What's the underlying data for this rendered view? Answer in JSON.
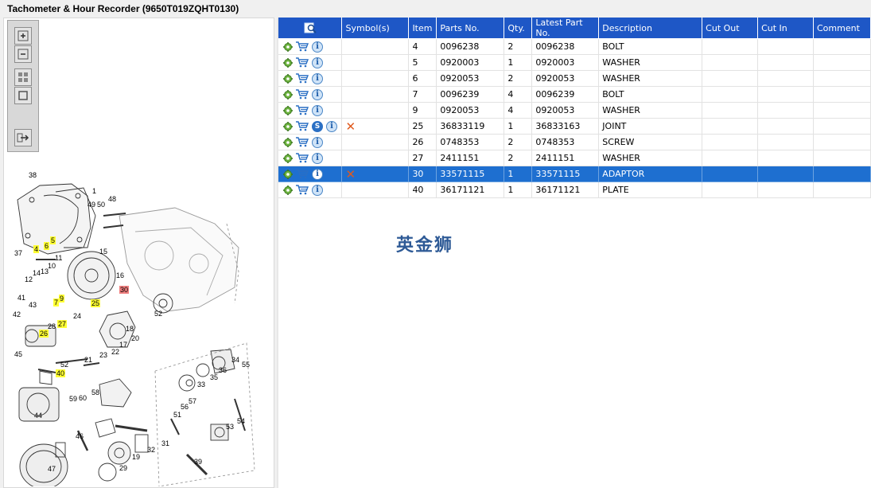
{
  "window": {
    "title": "Tachometer & Hour Recorder (9650T019ZQHT0130)"
  },
  "toolbar": {
    "buttons": [
      {
        "name": "zoom-in-button",
        "icon": "zoom-in-icon"
      },
      {
        "name": "zoom-out-button",
        "icon": "zoom-out-icon"
      },
      {
        "name": "fit-all-button",
        "icon": "fit-all-icon"
      },
      {
        "name": "fit-page-button",
        "icon": "fit-page-icon"
      },
      {
        "name": "export-button",
        "icon": "export-icon"
      }
    ]
  },
  "table": {
    "headers": [
      "",
      "Symbol(s)",
      "Item",
      "Parts No.",
      "Qty.",
      "Latest Part No.",
      "Description",
      "Cut Out",
      "Cut In",
      "Comment"
    ],
    "rows": [
      {
        "item": "4",
        "parts_no": "0096238",
        "qty": "2",
        "latest": "0096238",
        "desc": "BOLT",
        "cut_out": "",
        "cut_in": "",
        "comment": "",
        "has_s": false,
        "symbol_x": false,
        "selected": false
      },
      {
        "item": "5",
        "parts_no": "0920003",
        "qty": "1",
        "latest": "0920003",
        "desc": "WASHER",
        "cut_out": "",
        "cut_in": "",
        "comment": "",
        "has_s": false,
        "symbol_x": false,
        "selected": false
      },
      {
        "item": "6",
        "parts_no": "0920053",
        "qty": "2",
        "latest": "0920053",
        "desc": "WASHER",
        "cut_out": "",
        "cut_in": "",
        "comment": "",
        "has_s": false,
        "symbol_x": false,
        "selected": false
      },
      {
        "item": "7",
        "parts_no": "0096239",
        "qty": "4",
        "latest": "0096239",
        "desc": "BOLT",
        "cut_out": "",
        "cut_in": "",
        "comment": "",
        "has_s": false,
        "symbol_x": false,
        "selected": false
      },
      {
        "item": "9",
        "parts_no": "0920053",
        "qty": "4",
        "latest": "0920053",
        "desc": "WASHER",
        "cut_out": "",
        "cut_in": "",
        "comment": "",
        "has_s": false,
        "symbol_x": false,
        "selected": false
      },
      {
        "item": "25",
        "parts_no": "36833119",
        "qty": "1",
        "latest": "36833163",
        "desc": "JOINT",
        "cut_out": "",
        "cut_in": "",
        "comment": "",
        "has_s": true,
        "symbol_x": true,
        "selected": false
      },
      {
        "item": "26",
        "parts_no": "0748353",
        "qty": "2",
        "latest": "0748353",
        "desc": "SCREW",
        "cut_out": "",
        "cut_in": "",
        "comment": "",
        "has_s": false,
        "symbol_x": false,
        "selected": false
      },
      {
        "item": "27",
        "parts_no": "2411151",
        "qty": "2",
        "latest": "2411151",
        "desc": "WASHER",
        "cut_out": "",
        "cut_in": "",
        "comment": "",
        "has_s": false,
        "symbol_x": false,
        "selected": false
      },
      {
        "item": "30",
        "parts_no": "33571115",
        "qty": "1",
        "latest": "33571115",
        "desc": "ADAPTOR",
        "cut_out": "",
        "cut_in": "",
        "comment": "",
        "has_s": false,
        "symbol_x": true,
        "selected": true
      },
      {
        "item": "40",
        "parts_no": "36171121",
        "qty": "1",
        "latest": "36171121",
        "desc": "PLATE",
        "cut_out": "",
        "cut_in": "",
        "comment": "",
        "has_s": false,
        "symbol_x": false,
        "selected": false
      }
    ],
    "icons": {
      "gear": "gear-icon",
      "cart": "cart-icon",
      "info": "info-icon",
      "s_badge": "S",
      "info_glyph": "i",
      "symbol_glyph": "✕"
    }
  },
  "watermark": "英金狮",
  "diagram": {
    "callouts": [
      {
        "label": "38",
        "hl": ""
      },
      {
        "label": "1",
        "hl": ""
      },
      {
        "label": "49",
        "hl": ""
      },
      {
        "label": "50",
        "hl": ""
      },
      {
        "label": "48",
        "hl": ""
      },
      {
        "label": "37",
        "hl": ""
      },
      {
        "label": "4",
        "hl": "yellow"
      },
      {
        "label": "6",
        "hl": "yellow"
      },
      {
        "label": "5",
        "hl": "yellow"
      },
      {
        "label": "15",
        "hl": ""
      },
      {
        "label": "10",
        "hl": ""
      },
      {
        "label": "11",
        "hl": ""
      },
      {
        "label": "14",
        "hl": ""
      },
      {
        "label": "13",
        "hl": ""
      },
      {
        "label": "12",
        "hl": ""
      },
      {
        "label": "16",
        "hl": ""
      },
      {
        "label": "30",
        "hl": "red"
      },
      {
        "label": "41",
        "hl": ""
      },
      {
        "label": "43",
        "hl": ""
      },
      {
        "label": "9",
        "hl": "yellow"
      },
      {
        "label": "7",
        "hl": "yellow"
      },
      {
        "label": "25",
        "hl": "yellow"
      },
      {
        "label": "42",
        "hl": ""
      },
      {
        "label": "28",
        "hl": ""
      },
      {
        "label": "24",
        "hl": ""
      },
      {
        "label": "26",
        "hl": "yellow"
      },
      {
        "label": "27",
        "hl": "yellow"
      },
      {
        "label": "52",
        "hl": ""
      },
      {
        "label": "18",
        "hl": ""
      },
      {
        "label": "20",
        "hl": ""
      },
      {
        "label": "17",
        "hl": ""
      },
      {
        "label": "22",
        "hl": ""
      },
      {
        "label": "23",
        "hl": ""
      },
      {
        "label": "45",
        "hl": ""
      },
      {
        "label": "21",
        "hl": ""
      },
      {
        "label": "52",
        "hl": ""
      },
      {
        "label": "40",
        "hl": "yellow"
      },
      {
        "label": "34",
        "hl": ""
      },
      {
        "label": "36",
        "hl": ""
      },
      {
        "label": "35",
        "hl": ""
      },
      {
        "label": "55",
        "hl": ""
      },
      {
        "label": "33",
        "hl": ""
      },
      {
        "label": "54",
        "hl": ""
      },
      {
        "label": "59",
        "hl": ""
      },
      {
        "label": "60",
        "hl": ""
      },
      {
        "label": "58",
        "hl": ""
      },
      {
        "label": "44",
        "hl": ""
      },
      {
        "label": "57",
        "hl": ""
      },
      {
        "label": "56",
        "hl": ""
      },
      {
        "label": "51",
        "hl": ""
      },
      {
        "label": "53",
        "hl": ""
      },
      {
        "label": "46",
        "hl": ""
      },
      {
        "label": "31",
        "hl": ""
      },
      {
        "label": "32",
        "hl": ""
      },
      {
        "label": "19",
        "hl": ""
      },
      {
        "label": "29",
        "hl": ""
      },
      {
        "label": "47",
        "hl": ""
      },
      {
        "label": "39",
        "hl": ""
      }
    ]
  }
}
